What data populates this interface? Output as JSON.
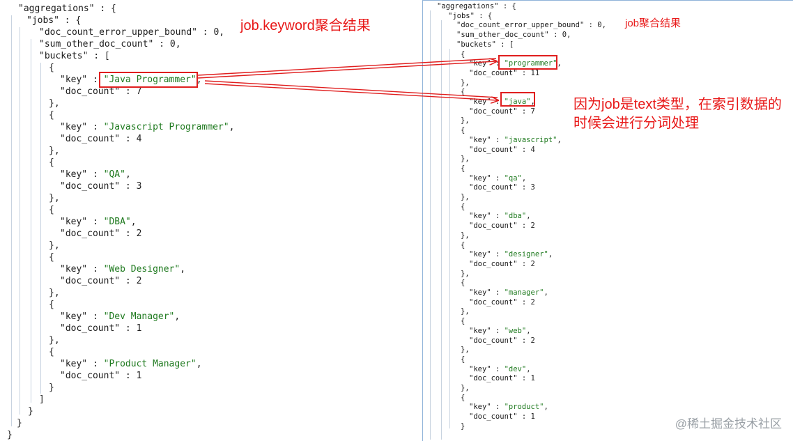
{
  "left_panel": {
    "lines": [
      {
        "t": [
          [
            "k",
            "\"aggregations\""
          ],
          [
            "p",
            " : {"
          ]
        ]
      },
      {
        "t": [
          [
            "k",
            "\"jobs\""
          ],
          [
            "p",
            " : {"
          ]
        ]
      },
      {
        "t": [
          [
            "k",
            "\"doc_count_error_upper_bound\""
          ],
          [
            "p",
            " : "
          ],
          [
            "n",
            "0"
          ],
          [
            "p",
            ","
          ]
        ]
      },
      {
        "t": [
          [
            "k",
            "\"sum_other_doc_count\""
          ],
          [
            "p",
            " : "
          ],
          [
            "n",
            "0"
          ],
          [
            "p",
            ","
          ]
        ]
      },
      {
        "t": [
          [
            "k",
            "\"buckets\""
          ],
          [
            "p",
            " : ["
          ]
        ]
      },
      {
        "t": [
          [
            "p",
            "{"
          ]
        ]
      },
      {
        "t": [
          [
            "k",
            "\"key\""
          ],
          [
            "p",
            " : "
          ],
          [
            "s",
            "\"Java Programmer\""
          ],
          [
            "p",
            ","
          ]
        ]
      },
      {
        "t": [
          [
            "k",
            "\"doc_count\""
          ],
          [
            "p",
            " : "
          ],
          [
            "n",
            "7"
          ]
        ]
      },
      {
        "t": [
          [
            "p",
            "},"
          ]
        ]
      },
      {
        "t": [
          [
            "p",
            "{"
          ]
        ]
      },
      {
        "t": [
          [
            "k",
            "\"key\""
          ],
          [
            "p",
            " : "
          ],
          [
            "s",
            "\"Javascript Programmer\""
          ],
          [
            "p",
            ","
          ]
        ]
      },
      {
        "t": [
          [
            "k",
            "\"doc_count\""
          ],
          [
            "p",
            " : "
          ],
          [
            "n",
            "4"
          ]
        ]
      },
      {
        "t": [
          [
            "p",
            "},"
          ]
        ]
      },
      {
        "t": [
          [
            "p",
            "{"
          ]
        ]
      },
      {
        "t": [
          [
            "k",
            "\"key\""
          ],
          [
            "p",
            " : "
          ],
          [
            "s",
            "\"QA\""
          ],
          [
            "p",
            ","
          ]
        ]
      },
      {
        "t": [
          [
            "k",
            "\"doc_count\""
          ],
          [
            "p",
            " : "
          ],
          [
            "n",
            "3"
          ]
        ]
      },
      {
        "t": [
          [
            "p",
            "},"
          ]
        ]
      },
      {
        "t": [
          [
            "p",
            "{"
          ]
        ]
      },
      {
        "t": [
          [
            "k",
            "\"key\""
          ],
          [
            "p",
            " : "
          ],
          [
            "s",
            "\"DBA\""
          ],
          [
            "p",
            ","
          ]
        ]
      },
      {
        "t": [
          [
            "k",
            "\"doc_count\""
          ],
          [
            "p",
            " : "
          ],
          [
            "n",
            "2"
          ]
        ]
      },
      {
        "t": [
          [
            "p",
            "},"
          ]
        ]
      },
      {
        "t": [
          [
            "p",
            "{"
          ]
        ]
      },
      {
        "t": [
          [
            "k",
            "\"key\""
          ],
          [
            "p",
            " : "
          ],
          [
            "s",
            "\"Web Designer\""
          ],
          [
            "p",
            ","
          ]
        ]
      },
      {
        "t": [
          [
            "k",
            "\"doc_count\""
          ],
          [
            "p",
            " : "
          ],
          [
            "n",
            "2"
          ]
        ]
      },
      {
        "t": [
          [
            "p",
            "},"
          ]
        ]
      },
      {
        "t": [
          [
            "p",
            "{"
          ]
        ]
      },
      {
        "t": [
          [
            "k",
            "\"key\""
          ],
          [
            "p",
            " : "
          ],
          [
            "s",
            "\"Dev Manager\""
          ],
          [
            "p",
            ","
          ]
        ]
      },
      {
        "t": [
          [
            "k",
            "\"doc_count\""
          ],
          [
            "p",
            " : "
          ],
          [
            "n",
            "1"
          ]
        ]
      },
      {
        "t": [
          [
            "p",
            "},"
          ]
        ]
      },
      {
        "t": [
          [
            "p",
            "{"
          ]
        ]
      },
      {
        "t": [
          [
            "k",
            "\"key\""
          ],
          [
            "p",
            " : "
          ],
          [
            "s",
            "\"Product Manager\""
          ],
          [
            "p",
            ","
          ]
        ]
      },
      {
        "t": [
          [
            "k",
            "\"doc_count\""
          ],
          [
            "p",
            " : "
          ],
          [
            "n",
            "1"
          ]
        ]
      },
      {
        "t": [
          [
            "p",
            "}"
          ]
        ]
      },
      {
        "t": [
          [
            "p",
            "]"
          ]
        ]
      },
      {
        "t": [
          [
            "p",
            "}"
          ]
        ]
      },
      {
        "t": [
          [
            "p",
            "}"
          ]
        ]
      },
      {
        "t": [
          [
            "p",
            "}"
          ]
        ]
      }
    ]
  },
  "right_panel": {
    "lines": [
      {
        "t": [
          [
            "k",
            "\"aggregations\""
          ],
          [
            "p",
            " : {"
          ]
        ]
      },
      {
        "t": [
          [
            "k",
            "\"jobs\""
          ],
          [
            "p",
            " : {"
          ]
        ]
      },
      {
        "t": [
          [
            "k",
            "\"doc_count_error_upper_bound\""
          ],
          [
            "p",
            " : "
          ],
          [
            "n",
            "0"
          ],
          [
            "p",
            ","
          ]
        ]
      },
      {
        "t": [
          [
            "k",
            "\"sum_other_doc_count\""
          ],
          [
            "p",
            " : "
          ],
          [
            "n",
            "0"
          ],
          [
            "p",
            ","
          ]
        ]
      },
      {
        "t": [
          [
            "k",
            "\"buckets\""
          ],
          [
            "p",
            " : ["
          ]
        ]
      },
      {
        "t": [
          [
            "p",
            "{"
          ]
        ]
      },
      {
        "t": [
          [
            "k",
            "\"key\""
          ],
          [
            "p",
            " : "
          ],
          [
            "s",
            "\"programmer\""
          ],
          [
            "p",
            ","
          ]
        ]
      },
      {
        "t": [
          [
            "k",
            "\"doc_count\""
          ],
          [
            "p",
            " : "
          ],
          [
            "n",
            "11"
          ]
        ]
      },
      {
        "t": [
          [
            "p",
            "},"
          ]
        ]
      },
      {
        "t": [
          [
            "p",
            "{"
          ]
        ]
      },
      {
        "t": [
          [
            "k",
            "\"key\""
          ],
          [
            "p",
            " : "
          ],
          [
            "s",
            "\"java\""
          ],
          [
            "p",
            ","
          ]
        ]
      },
      {
        "t": [
          [
            "k",
            "\"doc_count\""
          ],
          [
            "p",
            " : "
          ],
          [
            "n",
            "7"
          ]
        ]
      },
      {
        "t": [
          [
            "p",
            "},"
          ]
        ]
      },
      {
        "t": [
          [
            "p",
            "{"
          ]
        ]
      },
      {
        "t": [
          [
            "k",
            "\"key\""
          ],
          [
            "p",
            " : "
          ],
          [
            "s",
            "\"javascript\""
          ],
          [
            "p",
            ","
          ]
        ]
      },
      {
        "t": [
          [
            "k",
            "\"doc_count\""
          ],
          [
            "p",
            " : "
          ],
          [
            "n",
            "4"
          ]
        ]
      },
      {
        "t": [
          [
            "p",
            "},"
          ]
        ]
      },
      {
        "t": [
          [
            "p",
            "{"
          ]
        ]
      },
      {
        "t": [
          [
            "k",
            "\"key\""
          ],
          [
            "p",
            " : "
          ],
          [
            "s",
            "\"qa\""
          ],
          [
            "p",
            ","
          ]
        ]
      },
      {
        "t": [
          [
            "k",
            "\"doc_count\""
          ],
          [
            "p",
            " : "
          ],
          [
            "n",
            "3"
          ]
        ]
      },
      {
        "t": [
          [
            "p",
            "},"
          ]
        ]
      },
      {
        "t": [
          [
            "p",
            "{"
          ]
        ]
      },
      {
        "t": [
          [
            "k",
            "\"key\""
          ],
          [
            "p",
            " : "
          ],
          [
            "s",
            "\"dba\""
          ],
          [
            "p",
            ","
          ]
        ]
      },
      {
        "t": [
          [
            "k",
            "\"doc_count\""
          ],
          [
            "p",
            " : "
          ],
          [
            "n",
            "2"
          ]
        ]
      },
      {
        "t": [
          [
            "p",
            "},"
          ]
        ]
      },
      {
        "t": [
          [
            "p",
            "{"
          ]
        ]
      },
      {
        "t": [
          [
            "k",
            "\"key\""
          ],
          [
            "p",
            " : "
          ],
          [
            "s",
            "\"designer\""
          ],
          [
            "p",
            ","
          ]
        ]
      },
      {
        "t": [
          [
            "k",
            "\"doc_count\""
          ],
          [
            "p",
            " : "
          ],
          [
            "n",
            "2"
          ]
        ]
      },
      {
        "t": [
          [
            "p",
            "},"
          ]
        ]
      },
      {
        "t": [
          [
            "p",
            "{"
          ]
        ]
      },
      {
        "t": [
          [
            "k",
            "\"key\""
          ],
          [
            "p",
            " : "
          ],
          [
            "s",
            "\"manager\""
          ],
          [
            "p",
            ","
          ]
        ]
      },
      {
        "t": [
          [
            "k",
            "\"doc_count\""
          ],
          [
            "p",
            " : "
          ],
          [
            "n",
            "2"
          ]
        ]
      },
      {
        "t": [
          [
            "p",
            "},"
          ]
        ]
      },
      {
        "t": [
          [
            "p",
            "{"
          ]
        ]
      },
      {
        "t": [
          [
            "k",
            "\"key\""
          ],
          [
            "p",
            " : "
          ],
          [
            "s",
            "\"web\""
          ],
          [
            "p",
            ","
          ]
        ]
      },
      {
        "t": [
          [
            "k",
            "\"doc_count\""
          ],
          [
            "p",
            " : "
          ],
          [
            "n",
            "2"
          ]
        ]
      },
      {
        "t": [
          [
            "p",
            "},"
          ]
        ]
      },
      {
        "t": [
          [
            "p",
            "{"
          ]
        ]
      },
      {
        "t": [
          [
            "k",
            "\"key\""
          ],
          [
            "p",
            " : "
          ],
          [
            "s",
            "\"dev\""
          ],
          [
            "p",
            ","
          ]
        ]
      },
      {
        "t": [
          [
            "k",
            "\"doc_count\""
          ],
          [
            "p",
            " : "
          ],
          [
            "n",
            "1"
          ]
        ]
      },
      {
        "t": [
          [
            "p",
            "},"
          ]
        ]
      },
      {
        "t": [
          [
            "p",
            "{"
          ]
        ]
      },
      {
        "t": [
          [
            "k",
            "\"key\""
          ],
          [
            "p",
            " : "
          ],
          [
            "s",
            "\"product\""
          ],
          [
            "p",
            ","
          ]
        ]
      },
      {
        "t": [
          [
            "k",
            "\"doc_count\""
          ],
          [
            "p",
            " : "
          ],
          [
            "n",
            "1"
          ]
        ]
      },
      {
        "t": [
          [
            "p",
            "}"
          ]
        ]
      }
    ]
  },
  "annotations": {
    "left_title": "job.keyword聚合结果",
    "right_title": "job聚合结果",
    "note": "因为job是text类型，在索引数据的时候会进行分词处理"
  },
  "watermark": "@稀土掘金技术社区",
  "colors": {
    "annotation_red": "#e81919",
    "json_string_green": "#1f7a1f",
    "json_text": "#1c1c1c",
    "panel_border": "#8fb3d9",
    "watermark_gray": "#9aa0a6"
  }
}
